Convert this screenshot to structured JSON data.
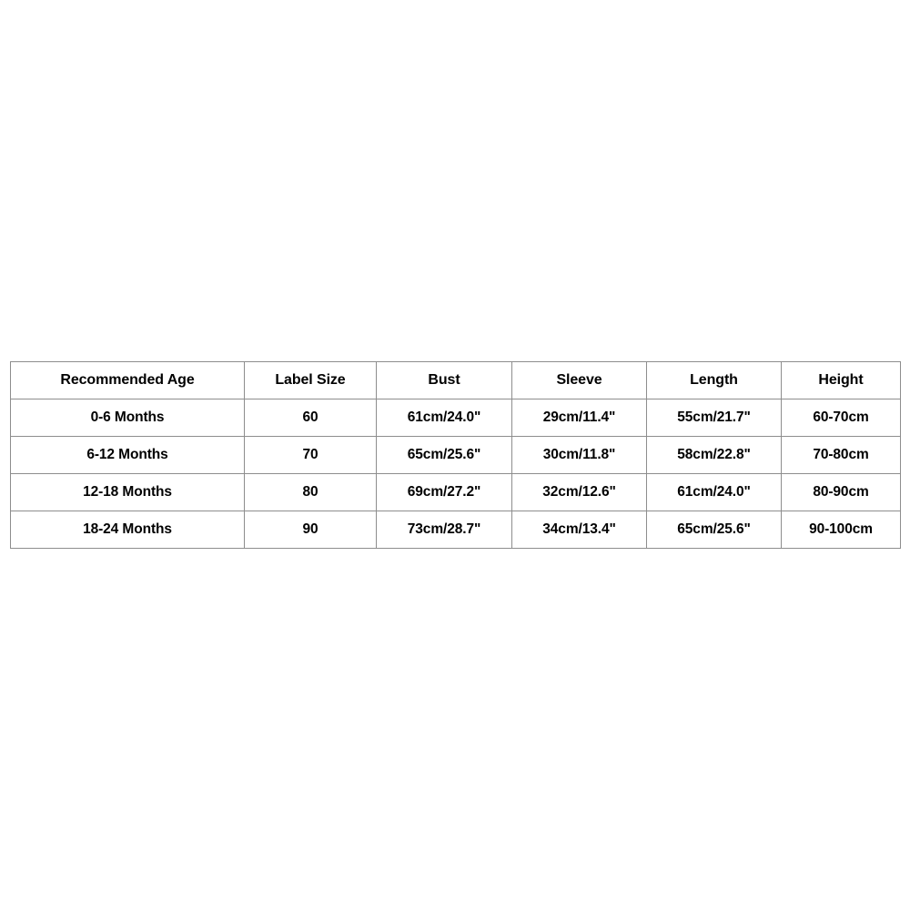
{
  "chart_data": {
    "type": "table",
    "title": "",
    "columns": [
      "Recommended Age",
      "Label Size",
      "Bust",
      "Sleeve",
      "Length",
      "Height"
    ],
    "rows": [
      [
        "0-6 Months",
        "60",
        "61cm/24.0\"",
        "29cm/11.4\"",
        "55cm/21.7\"",
        "60-70cm"
      ],
      [
        "6-12 Months",
        "70",
        "65cm/25.6\"",
        "30cm/11.8\"",
        "58cm/22.8\"",
        "70-80cm"
      ],
      [
        "12-18 Months",
        "80",
        "69cm/27.2\"",
        "32cm/12.6\"",
        "61cm/24.0\"",
        "80-90cm"
      ],
      [
        "18-24 Months",
        "90",
        "73cm/28.7\"",
        "34cm/13.4\"",
        "65cm/25.6\"",
        "90-100cm"
      ]
    ]
  },
  "size_chart": {
    "headers": {
      "recommended_age": "Recommended Age",
      "label_size": "Label Size",
      "bust": "Bust",
      "sleeve": "Sleeve",
      "length": "Length",
      "height": "Height"
    },
    "rows": [
      {
        "recommended_age": "0-6 Months",
        "label_size": "60",
        "bust": "61cm/24.0\"",
        "sleeve": "29cm/11.4\"",
        "length": "55cm/21.7\"",
        "height": "60-70cm"
      },
      {
        "recommended_age": "6-12 Months",
        "label_size": "70",
        "bust": "65cm/25.6\"",
        "sleeve": "30cm/11.8\"",
        "length": "58cm/22.8\"",
        "height": "70-80cm"
      },
      {
        "recommended_age": "12-18 Months",
        "label_size": "80",
        "bust": "69cm/27.2\"",
        "sleeve": "32cm/12.6\"",
        "length": "61cm/24.0\"",
        "height": "80-90cm"
      },
      {
        "recommended_age": "18-24 Months",
        "label_size": "90",
        "bust": "73cm/28.7\"",
        "sleeve": "34cm/13.4\"",
        "length": "65cm/25.6\"",
        "height": "90-100cm"
      }
    ]
  },
  "colors": {
    "background": "#ffffff",
    "border": "#8d8d8d",
    "text": "#000000"
  }
}
